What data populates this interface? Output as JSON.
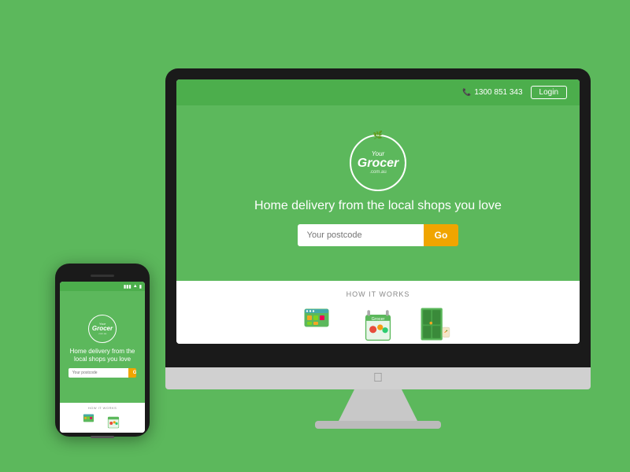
{
  "background_color": "#5cb85c",
  "header": {
    "phone_number": "1300 851 343",
    "login_label": "Login"
  },
  "logo": {
    "your_text": "Your",
    "grocer_text": "Grocer",
    "comau_text": ".com.au",
    "icon": "🌿"
  },
  "hero": {
    "tagline": "Home delivery from the local shops you love",
    "postcode_placeholder": "Your postcode",
    "go_label": "Go"
  },
  "how_it_works": {
    "title": "HOW IT WORKS"
  },
  "iphone": {
    "tagline": "Home delivery from the local shops you love",
    "postcode_placeholder": "Your postcode",
    "go_label": "Go",
    "how_it_works_title": "HOW IT WORKS"
  }
}
